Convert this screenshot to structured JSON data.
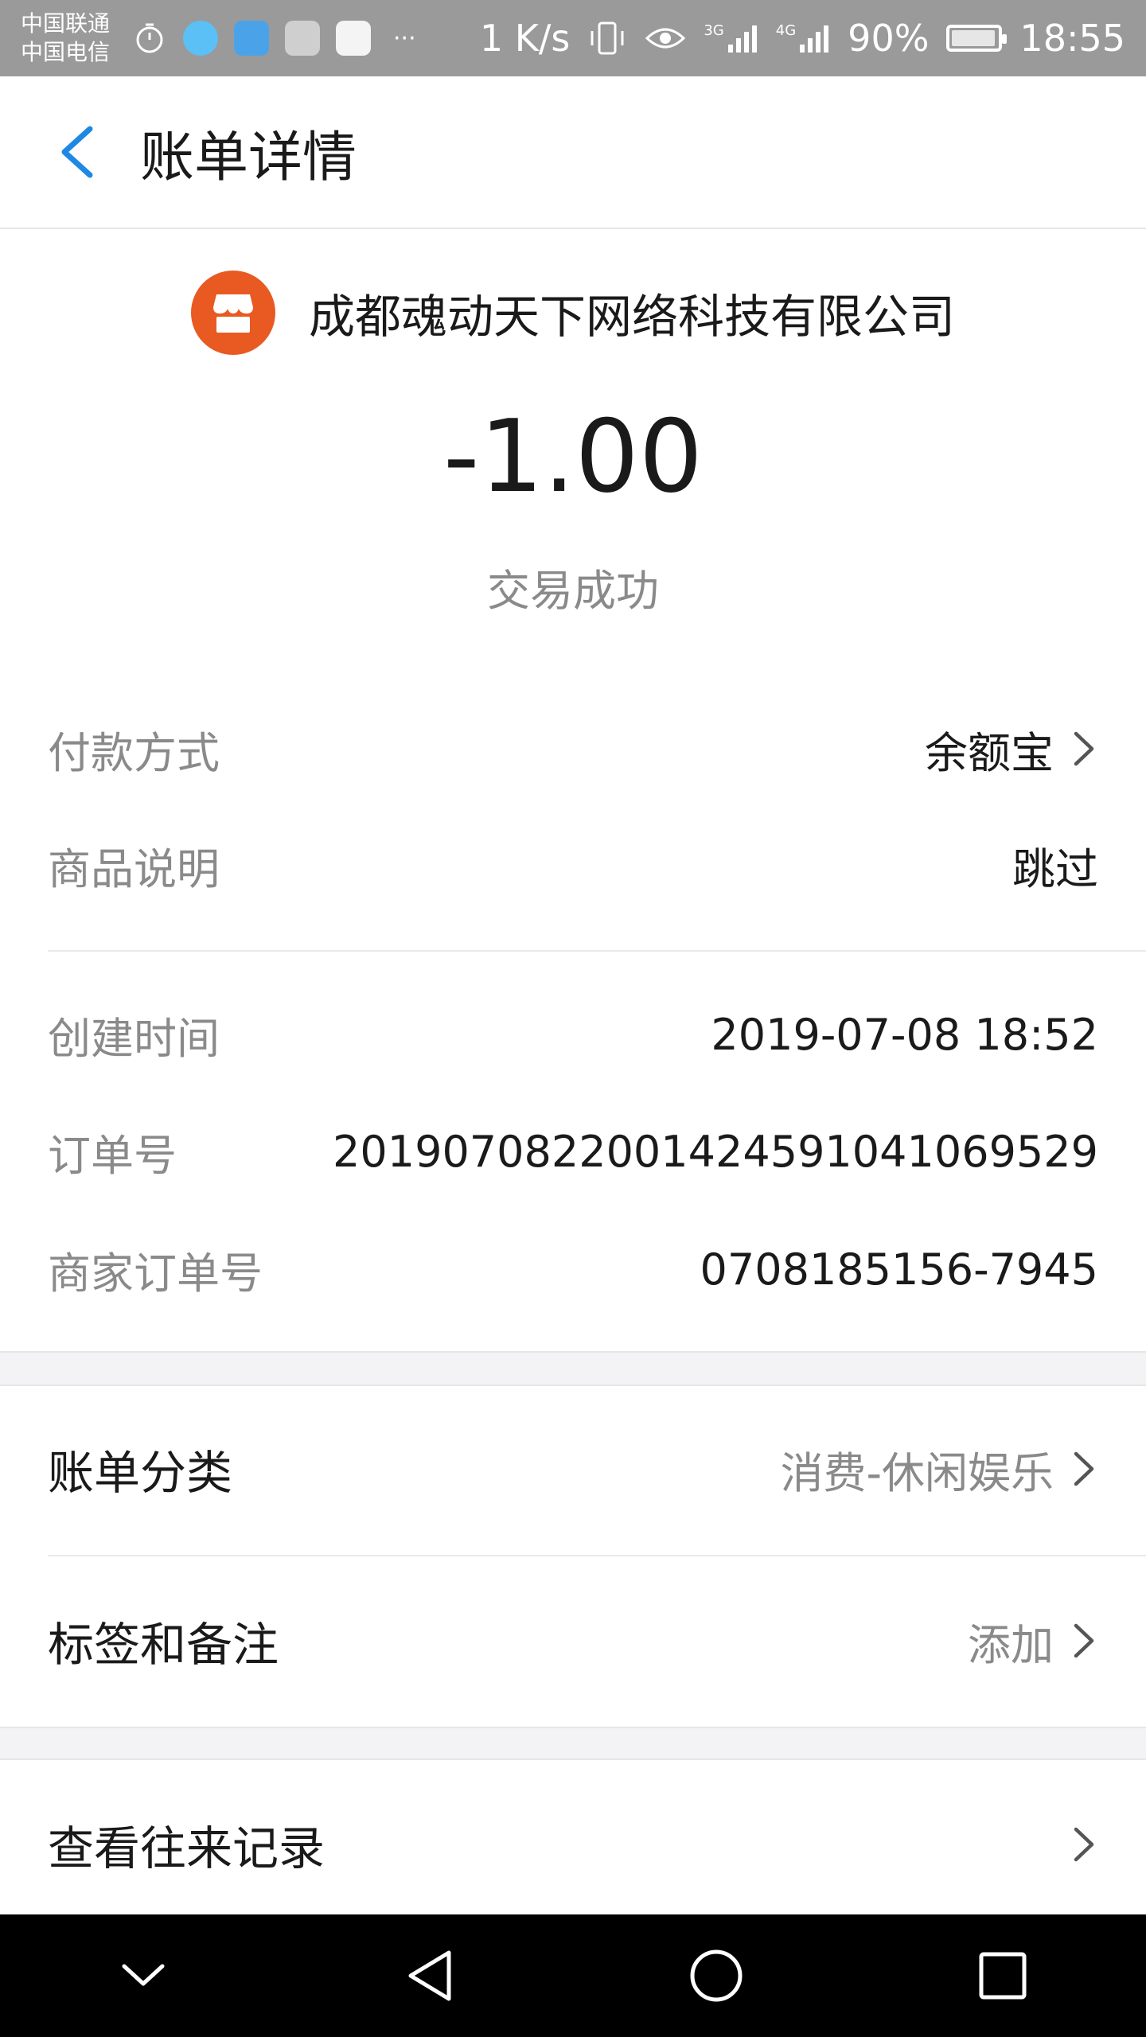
{
  "status_bar": {
    "carrier_1": "中国联通",
    "carrier_2": "中国电信",
    "speed": "1 K/s",
    "network_3g": "3G",
    "network_4g": "4G",
    "battery": "90%",
    "time": "18:55",
    "more": "···"
  },
  "header": {
    "title": "账单详情"
  },
  "merchant": {
    "name": "成都魂动天下网络科技有限公司",
    "amount": "-1.00",
    "status": "交易成功"
  },
  "details": {
    "payment_method": {
      "label": "付款方式",
      "value": "余额宝"
    },
    "product_desc": {
      "label": "商品说明",
      "value": "跳过"
    },
    "created_time": {
      "label": "创建时间",
      "value": "2019-07-08 18:52"
    },
    "order_no": {
      "label": "订单号",
      "value": "20190708220014245910410695​29"
    },
    "merchant_order_no": {
      "label": "商家订单号",
      "value": "0708185156-7945"
    }
  },
  "category": {
    "label": "账单分类",
    "value": "消费-休闲娱乐"
  },
  "tags": {
    "label": "标签和备注",
    "value": "添加"
  },
  "history": {
    "label": "查看往来记录"
  },
  "colors": {
    "accent": "#1e88e5",
    "merchant_icon": "#e85a22",
    "status_bar": "#9a9a9a"
  }
}
